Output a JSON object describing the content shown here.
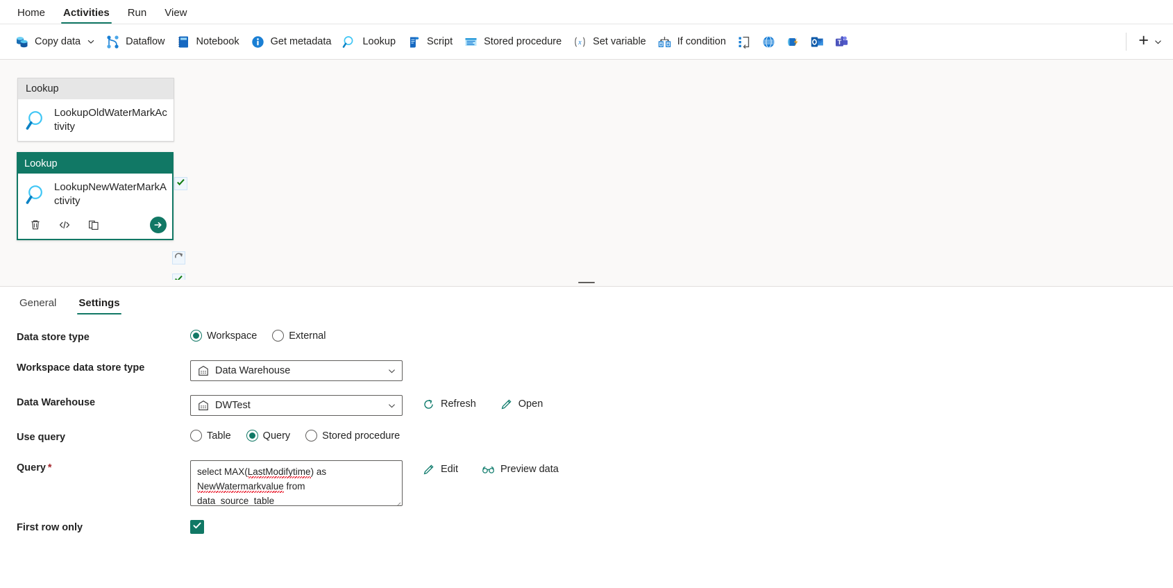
{
  "ribbon": {
    "tabs": [
      {
        "label": "Home",
        "active": false
      },
      {
        "label": "Activities",
        "active": true
      },
      {
        "label": "Run",
        "active": false
      },
      {
        "label": "View",
        "active": false
      }
    ]
  },
  "toolbar": {
    "items": [
      {
        "label": "Copy data",
        "icon": "copy-data-icon",
        "has_caret": true
      },
      {
        "label": "Dataflow",
        "icon": "dataflow-icon",
        "has_caret": false
      },
      {
        "label": "Notebook",
        "icon": "notebook-icon",
        "has_caret": false
      },
      {
        "label": "Get metadata",
        "icon": "info-icon",
        "has_caret": false
      },
      {
        "label": "Lookup",
        "icon": "lookup-magnifier-icon",
        "has_caret": false
      },
      {
        "label": "Script",
        "icon": "script-scroll-icon",
        "has_caret": false
      },
      {
        "label": "Stored procedure",
        "icon": "stored-procedure-icon",
        "has_caret": false
      },
      {
        "label": "Set variable",
        "icon": "set-variable-fx-icon",
        "has_caret": false
      },
      {
        "label": "If condition",
        "icon": "if-condition-icon",
        "has_caret": false
      }
    ],
    "icon_only": [
      {
        "icon": "for-each-icon"
      },
      {
        "icon": "web-globe-icon"
      },
      {
        "icon": "azure-function-icon"
      },
      {
        "icon": "outlook-icon"
      },
      {
        "icon": "teams-icon"
      }
    ],
    "add_label": "+"
  },
  "canvas": {
    "nodes": [
      {
        "header": "Lookup",
        "title": "LookupOldWaterMarkActivity",
        "icon": "lookup-magnifier-icon",
        "selected": false,
        "chips": [
          {
            "icon": "success-check-icon",
            "state": "success"
          }
        ]
      },
      {
        "header": "Lookup",
        "title": "LookupNewWaterMarkActivity",
        "icon": "lookup-magnifier-icon",
        "selected": true,
        "actions": [
          {
            "icon": "delete-trash-icon",
            "name": "delete-activity-button"
          },
          {
            "icon": "code-view-icon",
            "name": "view-code-button"
          },
          {
            "icon": "duplicate-copy-icon",
            "name": "duplicate-activity-button"
          }
        ],
        "run_action": {
          "icon": "run-arrow-icon",
          "name": "run-activity-button"
        },
        "chips": [
          {
            "icon": "on-completion-icon",
            "state": "completion"
          },
          {
            "icon": "success-check-icon",
            "state": "success"
          },
          {
            "icon": "failure-x-icon",
            "state": "failure"
          },
          {
            "icon": "on-skip-arrow-icon",
            "state": "skip"
          }
        ]
      }
    ]
  },
  "panel": {
    "tabs": [
      {
        "label": "General",
        "active": false
      },
      {
        "label": "Settings",
        "active": true
      }
    ],
    "fields": {
      "data_store_type": {
        "label": "Data store type",
        "options": [
          {
            "label": "Workspace",
            "checked": true
          },
          {
            "label": "External",
            "checked": false
          }
        ]
      },
      "workspace_data_store_type": {
        "label": "Workspace data store type",
        "value": "Data Warehouse",
        "icon": "warehouse-icon"
      },
      "data_warehouse": {
        "label": "Data Warehouse",
        "value": "DWTest",
        "icon": "warehouse-icon",
        "actions": [
          {
            "label": "Refresh",
            "icon": "refresh-icon"
          },
          {
            "label": "Open",
            "icon": "pencil-edit-icon"
          }
        ]
      },
      "use_query": {
        "label": "Use query",
        "options": [
          {
            "label": "Table",
            "checked": false
          },
          {
            "label": "Query",
            "checked": true
          },
          {
            "label": "Stored procedure",
            "checked": false
          }
        ]
      },
      "query": {
        "label": "Query",
        "required": true,
        "value_line1_a": "select MAX(",
        "value_line1_b": "LastModifytime",
        "value_line1_c": ") as",
        "value_line2_a": "NewWatermarkvalue",
        "value_line2_b": " from",
        "value_line3_a": "data_source_table",
        "full_value": "select MAX(LastModifytime) as NewWatermarkvalue from data_source_table",
        "actions": [
          {
            "label": "Edit",
            "icon": "pencil-edit-icon"
          },
          {
            "label": "Preview data",
            "icon": "preview-glasses-icon"
          }
        ]
      },
      "first_row_only": {
        "label": "First row only",
        "checked": true
      }
    }
  }
}
